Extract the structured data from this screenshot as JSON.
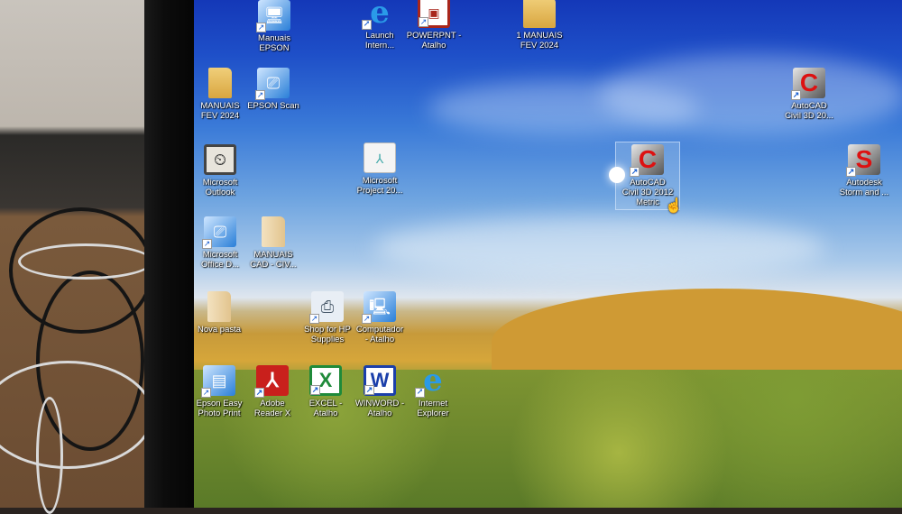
{
  "desktop_icons": [
    {
      "label": "Manuais\nEPSON",
      "icon": "monitor-shortcut-icon"
    },
    {
      "label": "Launch\nIntern...",
      "icon": "internet-explorer-icon"
    },
    {
      "label": "POWERPNT -\nAtalho",
      "icon": "powerpoint-icon"
    },
    {
      "label": "1 MANUAIS\nFEV 2024",
      "icon": "folder-icon"
    },
    {
      "label": "MANUAIS\nFEV 2024",
      "icon": "folder-icon"
    },
    {
      "label": "EPSON Scan",
      "icon": "scanner-icon"
    },
    {
      "label": "AutoCAD\nCivil 3D 20...",
      "icon": "autocad-icon"
    },
    {
      "label": "Microsoft\nOutlook",
      "icon": "outlook-icon"
    },
    {
      "label": "Microsoft\nProject 20...",
      "icon": "pdf-document-icon"
    },
    {
      "label": "AutoCAD\nCivil 3D 2012\nMetric",
      "icon": "autocad-icon",
      "selected": true
    },
    {
      "label": "Autodesk\nStorm and ...",
      "icon": "autodesk-storm-icon"
    },
    {
      "label": "Microsoft\nOffice D...",
      "icon": "scanner-icon"
    },
    {
      "label": "MANUAIS\nCAD - CIV...",
      "icon": "folder-icon"
    },
    {
      "label": "Nova pasta",
      "icon": "folder-icon"
    },
    {
      "label": "Shop for HP\nSupplies",
      "icon": "printer-icon"
    },
    {
      "label": "Computador\n- Atalho",
      "icon": "computer-icon"
    },
    {
      "label": "Epson Easy\nPhoto Print",
      "icon": "photo-print-icon"
    },
    {
      "label": "Adobe\nReader X",
      "icon": "adobe-reader-icon"
    },
    {
      "label": "EXCEL -\nAtalho",
      "icon": "excel-icon"
    },
    {
      "label": "WINWORD -\nAtalho",
      "icon": "word-icon"
    },
    {
      "label": "Internet\nExplorer",
      "icon": "internet-explorer-icon"
    }
  ],
  "glyphs": {
    "ie": "e",
    "pdf": "⅄",
    "excel": "X",
    "word": "W",
    "ppt": "▣",
    "outlook": "⏲",
    "acad": "C",
    "storm": "S",
    "monitor": "🖥",
    "scanner": "⎚",
    "printer": "⎙",
    "computer": "🖳",
    "photo": "▤",
    "shortcut": "↗"
  }
}
